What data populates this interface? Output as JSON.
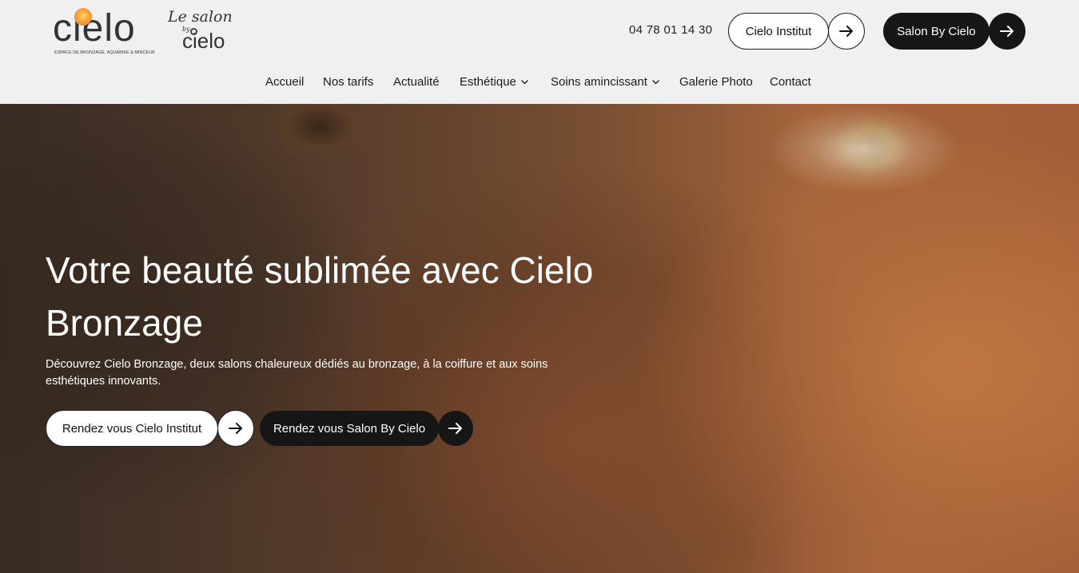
{
  "brand": {
    "logo_word": "cielo",
    "logo_tagline": "ESPACE DE BRONZAGE, AQUABIKE & MINCEUR",
    "salon_le": "Le salon",
    "salon_by": "by",
    "salon_word": "cielo"
  },
  "header": {
    "phone": "04 78 01 14 30",
    "btn_institut": "Cielo Institut",
    "btn_salon": "Salon By Cielo"
  },
  "nav": {
    "items": [
      {
        "label": "Accueil"
      },
      {
        "label": "Nos tarifs"
      },
      {
        "label": "Actualité"
      },
      {
        "label": "Esthétique"
      },
      {
        "label": "Soins amincissant"
      },
      {
        "label": "Galerie Photo"
      },
      {
        "label": "Contact"
      }
    ]
  },
  "hero": {
    "title": "Votre beauté sublimée avec Cielo Bronzage",
    "description": "Découvrez Cielo Bronzage, deux salons chaleureux dédiés au bronzage, à la coiffure et aux soins esthétiques innovants.",
    "cta_institut": "Rendez vous Cielo Institut",
    "cta_salon": "Rendez vous Salon By Cielo"
  },
  "icons": {
    "arrow": "arrow-right-icon",
    "chevron": "chevron-down-icon"
  },
  "colors": {
    "dark": "#161616",
    "light": "#ffffff",
    "header_bg": "#f0f0f0"
  }
}
